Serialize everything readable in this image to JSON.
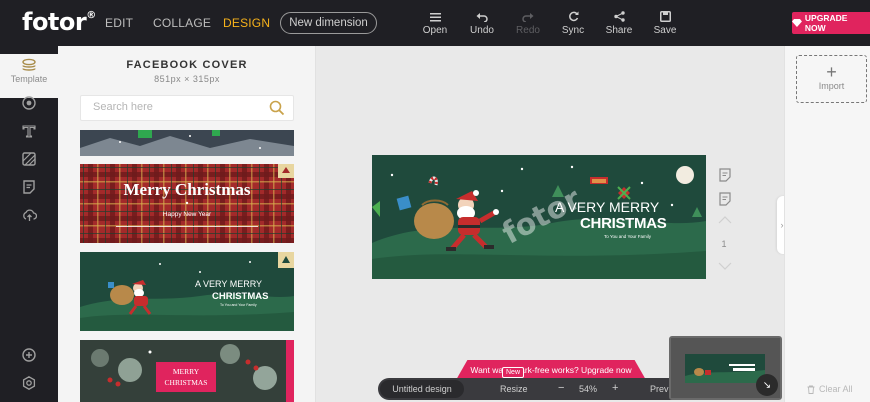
{
  "header": {
    "logo": "fotor",
    "logo_mark": "®",
    "modes": [
      {
        "label": "EDIT",
        "active": false
      },
      {
        "label": "COLLAGE",
        "active": false
      },
      {
        "label": "DESIGN",
        "active": true
      }
    ],
    "new_dimension": "New dimension",
    "tools": [
      {
        "label": "Open",
        "icon": "menu-icon",
        "disabled": false
      },
      {
        "label": "Undo",
        "icon": "undo-icon",
        "disabled": false
      },
      {
        "label": "Redo",
        "icon": "redo-icon",
        "disabled": true
      },
      {
        "label": "Sync",
        "icon": "sync-icon",
        "disabled": false
      },
      {
        "label": "Share",
        "icon": "share-icon",
        "disabled": false
      },
      {
        "label": "Save",
        "icon": "save-icon",
        "disabled": false
      }
    ],
    "upgrade": "UPGRADE NOW"
  },
  "rail": {
    "template_label": "Template",
    "items": [
      "layers-icon",
      "sticker-icon",
      "text-icon",
      "background-icon",
      "frame-icon",
      "upload-icon"
    ],
    "bottom_items": [
      "help-icon",
      "settings-icon"
    ]
  },
  "panel": {
    "title": "FACEBOOK COVER",
    "subtitle": "851px × 315px",
    "search_placeholder": "Search here",
    "templates": [
      {
        "type": "photo-strip"
      },
      {
        "type": "plaid",
        "title": "Merry Christmas",
        "subtitle": "Happy New Year"
      },
      {
        "type": "santa",
        "line1": "A VERY MERRY",
        "line2": "CHRISTMAS",
        "line3": "To You and Your Family"
      },
      {
        "type": "berries",
        "line1": "MERRY",
        "line2": "CHRISTMAS"
      }
    ]
  },
  "canvas": {
    "line1": "A VERY MERRY",
    "line2": "CHRISTMAS",
    "line3": "To You and Your Family",
    "watermark": "fotor",
    "page_number": "1"
  },
  "rightpanel": {
    "import_label": "Import",
    "clear_all": "Clear All"
  },
  "bottom": {
    "promo": "Want watermark-free works? Upgrade now",
    "new_badge": "New",
    "doc_name": "Untitled design",
    "resize": "Resize",
    "zoom_minus": "−",
    "zoom": "54%",
    "zoom_plus": "+",
    "preview": "Preview"
  },
  "colors": {
    "accent": "#f6b21b",
    "brand_pink": "#e0245e",
    "dark_bar": "#1f1f24",
    "card_green": "#1f4a3c",
    "plaid_red": "#a32a2a"
  }
}
